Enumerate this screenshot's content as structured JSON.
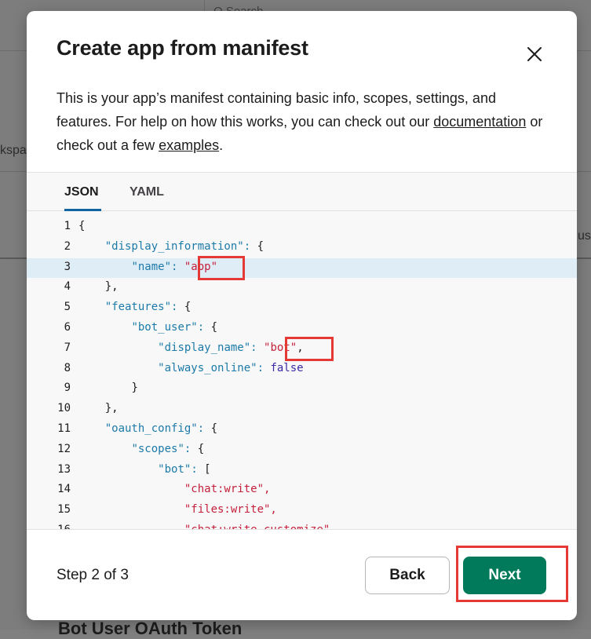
{
  "background": {
    "search_fragment": "Q  Search",
    "left_fragment": "kspa",
    "right_fragment": "us",
    "bottom_fragment": "Bot User OAuth Token"
  },
  "modal": {
    "title": "Create app from manifest",
    "desc_part1": "This is your app’s manifest containing basic info, scopes, settings, and features. For help on how this works, you can check out our ",
    "doc_link": "documentation",
    "desc_part2": " or check out a few ",
    "examples_link": "examples",
    "desc_part3": ".",
    "tabs": {
      "json": "JSON",
      "yaml": "YAML"
    },
    "step_text": "Step 2 of 3",
    "back_label": "Back",
    "next_label": "Next"
  },
  "code_lines": [
    "{",
    "\"display_information\": {",
    "\"name\": \"app\"",
    "},",
    "\"features\": {",
    "\"bot_user\": {",
    "\"display_name\": \"bot\",",
    "\"always_online\": false",
    "}",
    "},",
    "\"oauth_config\": {",
    "\"scopes\": {",
    "\"bot\": [",
    "\"chat:write\",",
    "\"files:write\",",
    "\"chat:write.customize\""
  ],
  "colors": {
    "accent": "#1264a3",
    "primary_button": "#007a5a",
    "annotation": "#e53935",
    "highlight": "#dfedf7"
  }
}
